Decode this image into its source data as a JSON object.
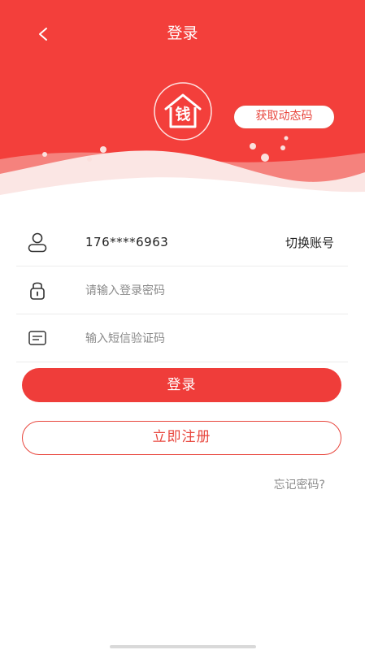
{
  "nav": {
    "title": "登录",
    "back_icon": "chevron-left-icon"
  },
  "logo": {
    "icon": "house-coin-icon",
    "glyph": "钱"
  },
  "account": {
    "phone": "176****6963",
    "switch_label": "切换账号",
    "icon": "user-icon"
  },
  "password": {
    "placeholder": "请输入登录密码",
    "icon": "lock-icon"
  },
  "sms": {
    "placeholder": "输入短信验证码",
    "icon": "message-icon",
    "get_code_label": "获取动态码"
  },
  "actions": {
    "login_label": "登录",
    "register_label": "立即注册",
    "forgot_label": "忘记密码?"
  },
  "colors": {
    "brand_red": "#f33f3b",
    "button_red": "#ef3d3a",
    "outline_red": "#e8463d"
  }
}
